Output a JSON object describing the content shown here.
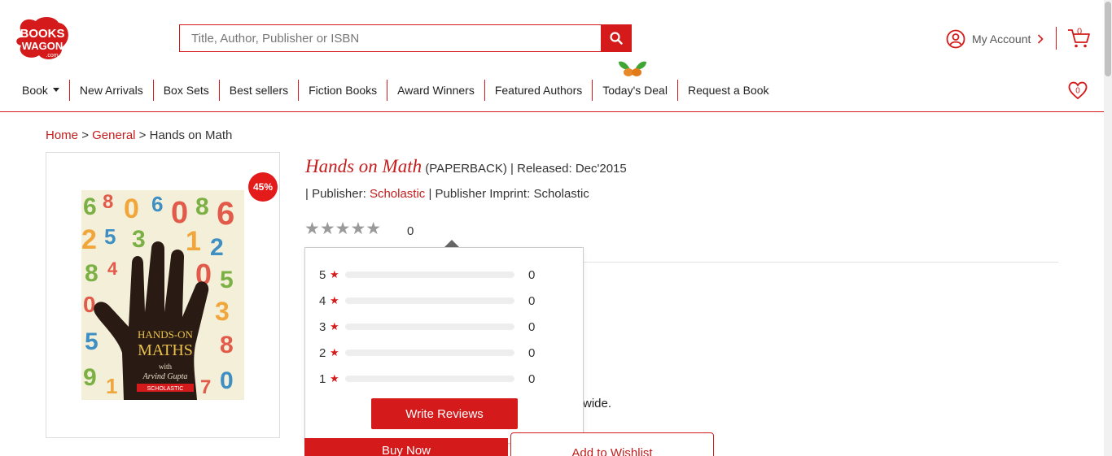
{
  "header": {
    "logo_line1": "BOOKS",
    "logo_line2": "WAGON",
    "logo_suffix": ".com",
    "search_placeholder": "Title, Author, Publisher or ISBN",
    "account_label": "My Account",
    "cart_count": "0",
    "wishlist_count": "0"
  },
  "nav": {
    "items": [
      {
        "label": "Book"
      },
      {
        "label": "New Arrivals"
      },
      {
        "label": "Box Sets"
      },
      {
        "label": "Best sellers"
      },
      {
        "label": "Fiction Books"
      },
      {
        "label": "Award Winners"
      },
      {
        "label": "Featured Authors"
      },
      {
        "label": "Today's Deal"
      },
      {
        "label": "Request a Book"
      }
    ]
  },
  "breadcrumb": {
    "home": "Home",
    "sep": ">",
    "category": "General",
    "current": "Hands on Math"
  },
  "product": {
    "discount": "45%",
    "cover": {
      "line1": "HANDS-ON",
      "line2": "MATHS",
      "line3": "with",
      "line4": "Arvind Gupta",
      "publisher": "SCHOLASTIC"
    },
    "title": "Hands on Math",
    "format": "(PAPERBACK)",
    "released_label": "| Released:",
    "released": "Dec'2015",
    "publisher_label": "| Publisher:",
    "publisher": "Scholastic",
    "imprint_label": "| Publisher Imprint:",
    "imprint": "Scholastic",
    "stars": "★★★★★",
    "rating_count": "0",
    "worldwide_text": "wide."
  },
  "rating_popup": {
    "star_glyph": "★",
    "rows": [
      {
        "stars": "5",
        "count": "0",
        "fraction": 0
      },
      {
        "stars": "4",
        "count": "0",
        "fraction": 0
      },
      {
        "stars": "3",
        "count": "0",
        "fraction": 0
      },
      {
        "stars": "2",
        "count": "0",
        "fraction": 0
      },
      {
        "stars": "1",
        "count": "0",
        "fraction": 0
      }
    ],
    "write_button": "Write Reviews"
  },
  "actions": {
    "buy_now": "Buy Now",
    "add_to_wishlist": "Add to Wishlist"
  },
  "colors": {
    "accent": "#d41a1a",
    "link": "#c41c1c"
  }
}
